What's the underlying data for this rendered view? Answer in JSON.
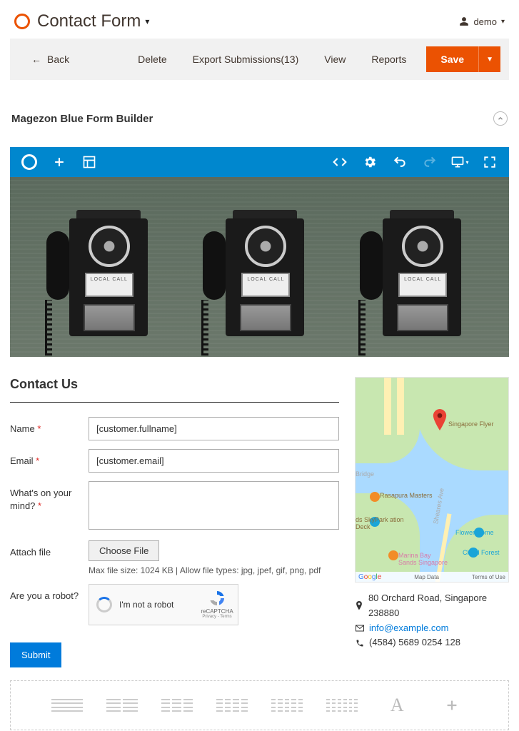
{
  "header": {
    "title": "Contact Form",
    "user": "demo"
  },
  "actions": {
    "back": "Back",
    "delete": "Delete",
    "export": "Export Submissions(13)",
    "view": "View",
    "reports": "Reports",
    "save": "Save"
  },
  "section_title": "Magezon Blue Form Builder",
  "phone_label": "LOCAL CALL",
  "form": {
    "heading": "Contact Us",
    "name_label": "Name",
    "name_value": "[customer.fullname]",
    "email_label": "Email",
    "email_value": "[customer.email]",
    "message_label": "What's on your mind?",
    "message_value": "",
    "attach_label": "Attach file",
    "choose_file": "Choose File",
    "file_hint": "Max file size: 1024 KB | Allow file types: jpg, jpef, gif, png, pdf",
    "robot_label": "Are you a robot?",
    "recaptcha_text": "I'm not a robot",
    "recaptcha_brand": "reCAPTCHA",
    "recaptcha_pp": "Privacy - Terms",
    "submit": "Submit"
  },
  "map": {
    "flyer_label": "Singapore Flyer",
    "rasapura_label": "Rasapura Masters",
    "skypark_label": "ds SkyPark\nation Deck",
    "mbs_label": "Marina Bay\nSands Singapore",
    "flower_label": "Flower Dome",
    "cloud_label": "Cloud Forest",
    "sheares": "Sheares Ave",
    "bridge": "Bridge",
    "google": "Google",
    "map_data": "Map Data",
    "terms": "Terms of Use"
  },
  "contact": {
    "address": "80 Orchard Road, Singapore 238880",
    "email": "info@example.com",
    "phone": "(4584) 5689 0254 128"
  }
}
